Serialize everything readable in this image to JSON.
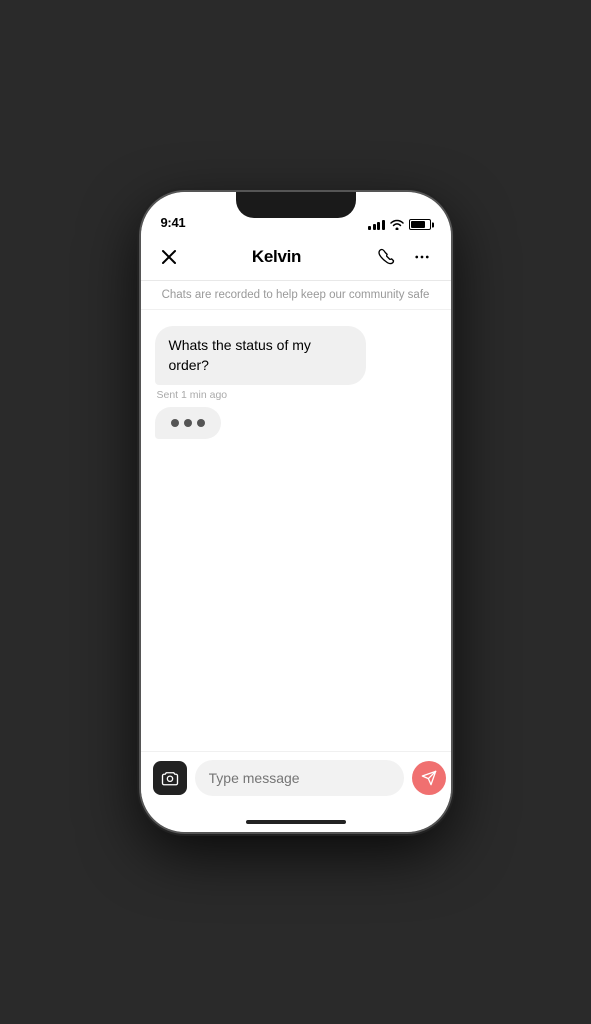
{
  "status_bar": {
    "time": "9:41",
    "signal_label": "signal",
    "wifi_label": "wifi",
    "battery_label": "battery"
  },
  "header": {
    "title": "Kelvin",
    "close_label": "×",
    "phone_icon": "📞",
    "more_icon": "···"
  },
  "safety_notice": {
    "text": "Chats are recorded to help keep our community safe"
  },
  "messages": [
    {
      "id": 1,
      "text": "Whats the status of my order?",
      "timestamp": "Sent 1 min ago",
      "type": "sent"
    }
  ],
  "typing_indicator": {
    "visible": true,
    "label": "typing"
  },
  "input_bar": {
    "placeholder": "Type message",
    "camera_label": "camera",
    "send_label": "send"
  }
}
